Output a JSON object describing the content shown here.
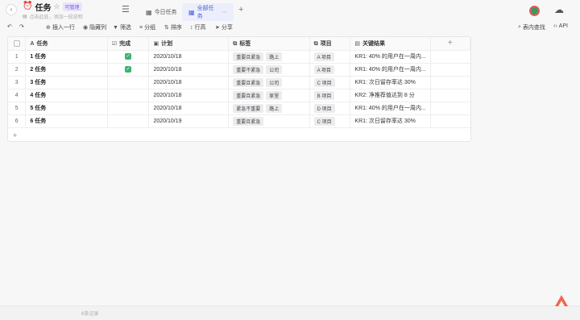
{
  "header": {
    "title": "任务",
    "badge": "可管理",
    "description": "点击此处，添加一段说明",
    "tabs": [
      {
        "label": "今日任务",
        "icon": "table-icon"
      },
      {
        "label": "全部任务",
        "icon": "table-icon",
        "more": "···"
      }
    ]
  },
  "toolbar": {
    "items": [
      "插入一行",
      "隐藏列",
      "筛选",
      "分组",
      "排序",
      "行高",
      "分享"
    ],
    "search": "表内查找",
    "api": "API"
  },
  "table": {
    "columns": [
      "任务",
      "完成",
      "计划",
      "标签",
      "项目",
      "关键结果"
    ],
    "rows": [
      {
        "num": "1",
        "task": "1 任务",
        "done": true,
        "date": "2020/10/18",
        "tags": [
          "重要且紧急",
          "路上"
        ],
        "project": "A 项目",
        "kr": "KR1: 40% 的用户在一周内..."
      },
      {
        "num": "2",
        "task": "2 任务",
        "done": true,
        "date": "2020/10/18",
        "tags": [
          "重要不紧急",
          "公司"
        ],
        "project": "A 项目",
        "kr": "KR1: 40% 的用户在一周内..."
      },
      {
        "num": "3",
        "task": "3 任务",
        "done": false,
        "date": "2020/10/18",
        "tags": [
          "重要且紧急",
          "公司"
        ],
        "project": "C 项目",
        "kr": "KR1: 次日留存率达 30%"
      },
      {
        "num": "4",
        "task": "4 任务",
        "done": false,
        "date": "2020/10/18",
        "tags": [
          "重要且紧急",
          "家里"
        ],
        "project": "B 项目",
        "kr": "KR2: 净推荐值达到 8 分"
      },
      {
        "num": "5",
        "task": "5 任务",
        "done": false,
        "date": "2020/10/18",
        "tags": [
          "紧急不重要",
          "路上"
        ],
        "project": "D 项目",
        "kr": "KR1: 40% 的用户在一周内..."
      },
      {
        "num": "6",
        "task": "6 任务",
        "done": false,
        "date": "2020/10/19",
        "tags": [
          "重要且紧急"
        ],
        "project": "C 项目",
        "kr": "KR1: 次日留存率达 30%"
      }
    ]
  },
  "footer": {
    "count": "6条记录"
  },
  "colors": {
    "accent": "#4a63d9",
    "done": "#3cb371",
    "logo": "#f0664a"
  }
}
